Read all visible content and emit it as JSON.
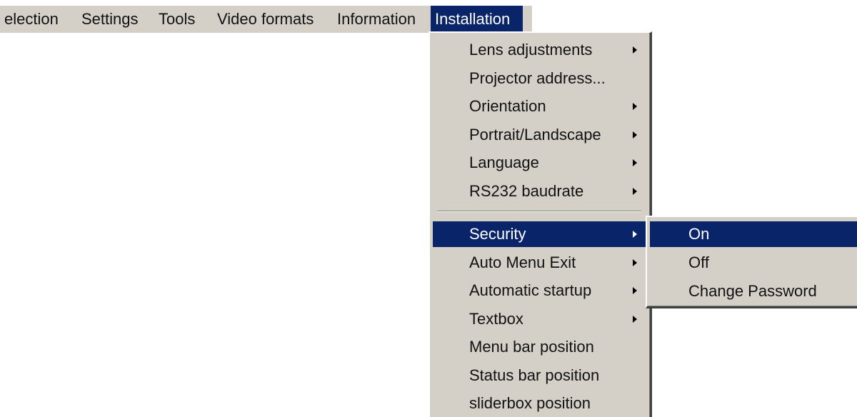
{
  "menubar": {
    "items": [
      {
        "label": "election"
      },
      {
        "label": "Settings"
      },
      {
        "label": "Tools"
      },
      {
        "label": "Video formats"
      },
      {
        "label": "Information"
      },
      {
        "label": "Installation",
        "active": true
      }
    ]
  },
  "installation_menu": {
    "items": [
      {
        "label": "Lens adjustments",
        "has_submenu": true
      },
      {
        "label": "Projector address...",
        "has_submenu": false
      },
      {
        "label": "Orientation",
        "has_submenu": true
      },
      {
        "label": "Portrait/Landscape",
        "has_submenu": true
      },
      {
        "label": "Language",
        "has_submenu": true
      },
      {
        "label": "RS232 baudrate",
        "has_submenu": true
      },
      {
        "label": "Security",
        "has_submenu": true,
        "highlighted": true
      },
      {
        "label": "Auto Menu Exit",
        "has_submenu": true
      },
      {
        "label": "Automatic startup",
        "has_submenu": true
      },
      {
        "label": "Textbox",
        "has_submenu": true
      },
      {
        "label": "Menu bar position",
        "has_submenu": false
      },
      {
        "label": "Status bar position",
        "has_submenu": false
      },
      {
        "label": "sliderbox position",
        "has_submenu": false
      }
    ]
  },
  "security_submenu": {
    "items": [
      {
        "label": "On",
        "highlighted": true
      },
      {
        "label": "Off"
      },
      {
        "label": "Change Password"
      }
    ]
  },
  "colors": {
    "menu_background": "#d4d0c8",
    "highlight": "#0a246a",
    "highlight_text": "#ffffff"
  },
  "icons": {
    "submenu_indicator": "submenu-arrow-icon"
  }
}
